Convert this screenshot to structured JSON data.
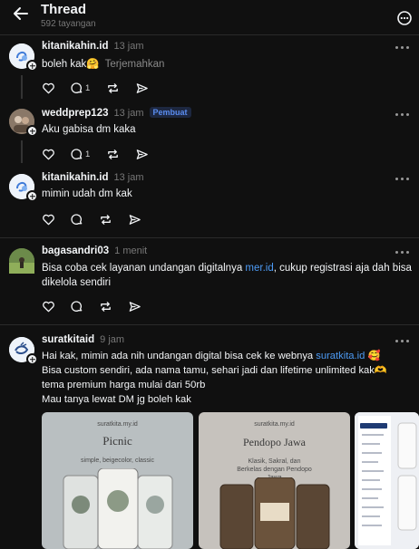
{
  "header": {
    "title": "Thread",
    "views": "592 tayangan"
  },
  "posts": [
    {
      "username": "kitanikahin.id",
      "time": "13 jam",
      "text": "boleh kak🤗",
      "translate": "Terjemahkan",
      "reply_count": "1"
    },
    {
      "username": "weddprep123",
      "time": "13 jam",
      "badge": "Pembuat",
      "text": "Aku gabisa dm kaka",
      "reply_count": "1"
    },
    {
      "username": "kitanikahin.id",
      "time": "13 jam",
      "text": "mimin udah dm kak"
    },
    {
      "username": "bagasandri03",
      "time": "1 menit",
      "text_before": "Bisa coba cek layanan undangan digitalnya ",
      "link": "mer.id",
      "text_after": ", cukup registrasi aja dah bisa",
      "text_line2": "dikelola sendiri"
    },
    {
      "username": "suratkitaid",
      "time": "9 jam",
      "line1_before": "Hai kak, mimin ada nih undangan digital bisa cek ke webnya ",
      "line1_link": "suratkita.id",
      "line1_emoji": "🥰",
      "line2": "Bisa custom sendiri, ada nama tamu, sehari jadi dan lifetime unlimited kak🫶",
      "line3": "tema premium harga mulai dari 50rb",
      "line4": "Mau tanya lewat DM jg boleh kak"
    }
  ],
  "media": [
    {
      "site": "suratkita.my.id",
      "name": "Picnic",
      "tags": "simple, beigecolor, classic"
    },
    {
      "site": "suratkita.my.id",
      "name": "Pendopo Jawa",
      "tags": "Klasik, Sakral, dan Berkelas dengan Pendopo Jawa"
    }
  ]
}
